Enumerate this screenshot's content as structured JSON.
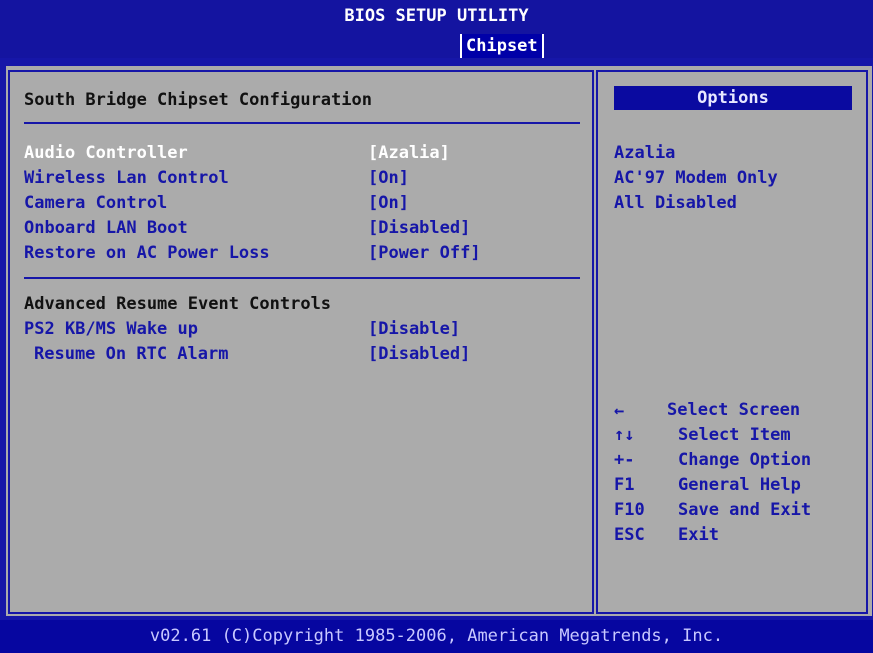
{
  "header": {
    "title": "BIOS SETUP UTILITY",
    "active_tab": "Chipset"
  },
  "main": {
    "section_title": "South Bridge Chipset Configuration",
    "settings": [
      {
        "label": "Audio Controller",
        "value": "[Azalia]",
        "selected": true
      },
      {
        "label": "Wireless Lan Control",
        "value": "[On]",
        "selected": false
      },
      {
        "label": "Camera Control",
        "value": "[On]",
        "selected": false
      },
      {
        "label": "Onboard LAN Boot",
        "value": "[Disabled]",
        "selected": false
      },
      {
        "label": "Restore on AC Power Loss",
        "value": "[Power Off]",
        "selected": false
      }
    ],
    "resume_section_title": "Advanced Resume Event Controls",
    "resume_settings": [
      {
        "label": "PS2 KB/MS Wake up",
        "value": "[Disable]"
      },
      {
        "label": "Resume On RTC Alarm",
        "value": "[Disabled]"
      }
    ]
  },
  "options_panel": {
    "header": "Options",
    "options": [
      "Azalia",
      "AC'97 Modem Only",
      "All Disabled"
    ]
  },
  "help": [
    {
      "key": "←",
      "action": "Select Screen"
    },
    {
      "key": "↑↓",
      "action": "Select Item"
    },
    {
      "key": "+-",
      "action": "Change Option"
    },
    {
      "key": "F1",
      "action": "General Help"
    },
    {
      "key": "F10",
      "action": "Save and Exit"
    },
    {
      "key": "ESC",
      "action": "Exit"
    }
  ],
  "footer": {
    "copyright": "v02.61 (C)Copyright 1985-2006, American Megatrends, Inc."
  },
  "colors": {
    "background": "#1616a8",
    "panel": "#ababab",
    "highlight": "#ffffff"
  }
}
